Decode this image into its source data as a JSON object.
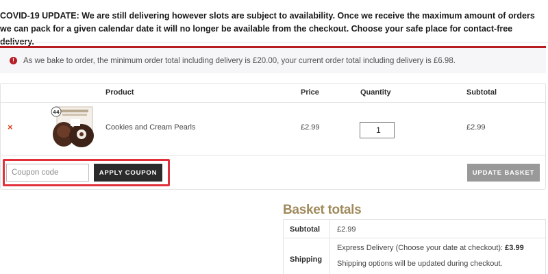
{
  "covid_notice": "COVID-19 UPDATE: We are still delivering however slots are subject to availability. Once we receive the maximum amount of orders we can pack for a given calendar date it will no longer be available from the checkout. Choose your safe place for contact-free delivery.",
  "error_notice": {
    "icon": "exclamation-icon",
    "text": "As we bake to order, the minimum order total including delivery is £20.00, your current order total including delivery is £6.98."
  },
  "cart": {
    "headers": {
      "product": "Product",
      "price": "Price",
      "quantity": "Quantity",
      "subtotal": "Subtotal"
    },
    "items": [
      {
        "remove_label": "×",
        "product_name": "Cookies and Cream Pearls",
        "price": "£2.99",
        "quantity": "1",
        "subtotal": "£2.99",
        "thumbnail_badge": "44"
      }
    ],
    "coupon": {
      "placeholder": "Coupon code",
      "apply_label": "APPLY COUPON"
    },
    "update_label": "UPDATE BASKET"
  },
  "totals": {
    "title": "Basket totals",
    "subtotal_label": "Subtotal",
    "subtotal_value": "£2.99",
    "shipping_label": "Shipping",
    "shipping_method": "Express Delivery (Choose your date at checkout):",
    "shipping_price": "£3.99",
    "shipping_note": "Shipping options will be updated during checkout."
  },
  "colors": {
    "accent_red": "#b81c23",
    "remove_red": "#e2401c",
    "highlight_red": "#e2303a",
    "title_gold": "#a08a5c",
    "dark_button": "#2b2b2b",
    "grey_button": "#999999"
  }
}
